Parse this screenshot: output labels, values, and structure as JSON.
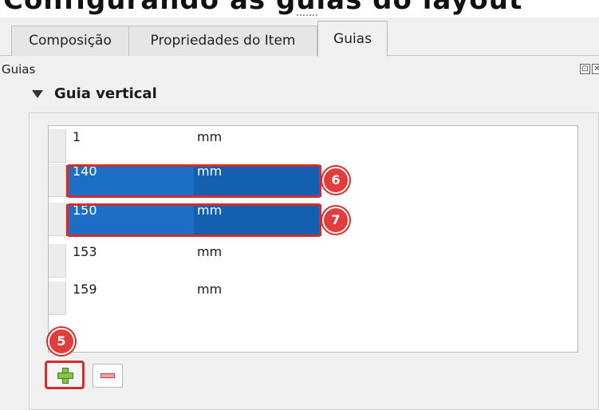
{
  "header": {
    "cropped_text": "Configurando as guias do layout"
  },
  "tabs": [
    {
      "label": "Composição",
      "active": false
    },
    {
      "label": "Propriedades do Item",
      "active": false
    },
    {
      "label": "Guias",
      "active": true
    }
  ],
  "panel": {
    "title": "Guias",
    "icons": [
      "float-icon",
      "close-icon"
    ]
  },
  "section": {
    "label": "Guia vertical",
    "expanded": true
  },
  "guides": [
    {
      "value": "1",
      "unit": "mm",
      "selected": false
    },
    {
      "value": "140",
      "unit": "mm",
      "selected": true
    },
    {
      "value": "150",
      "unit": "mm",
      "selected": true
    },
    {
      "value": "153",
      "unit": "mm",
      "selected": false
    },
    {
      "value": "159",
      "unit": "mm",
      "selected": false
    }
  ],
  "markers": [
    "5",
    "6",
    "7"
  ],
  "buttons": {
    "add_icon": "plus-icon",
    "remove_icon": "minus-icon"
  },
  "colors": {
    "selection": "#1c6fc4",
    "highlight": "#d62b2b"
  }
}
